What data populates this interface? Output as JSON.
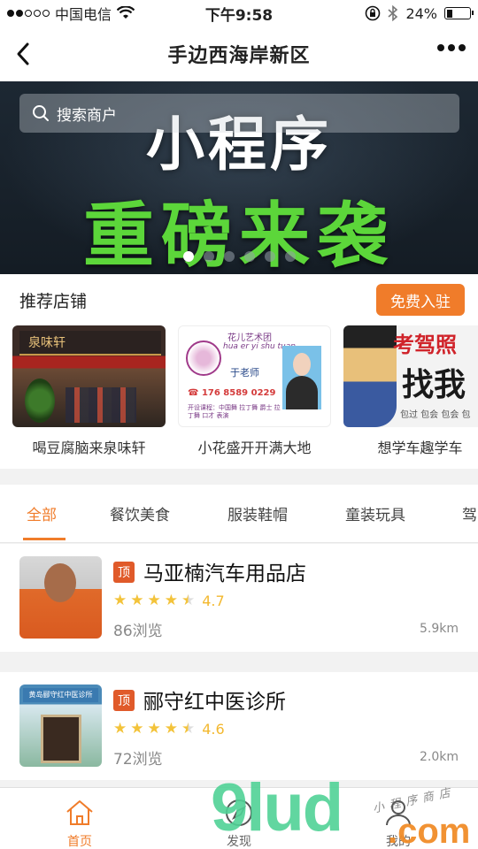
{
  "status_bar": {
    "carrier": "中国电信",
    "time": "下午9:58",
    "battery": "24%",
    "battery_level": 0.24,
    "signal_icon": "signal-dots-icon",
    "wifi_icon": "wifi-icon"
  },
  "nav": {
    "title": "手边西海岸新区",
    "back_icon": "back-chevron-icon",
    "more_icon": "more-dots-icon"
  },
  "banner": {
    "search_placeholder": "搜索商户",
    "line1": "小程序",
    "line2": "重磅来袭",
    "slide_count": 6,
    "active_slide": 1
  },
  "recommend": {
    "heading": "推荐店铺",
    "join_button": "免费入驻",
    "shops": [
      {
        "name": "喝豆腐脑来泉味轩",
        "sign_text": "泉味轩"
      },
      {
        "name": "小花盛开开满大地",
        "img_title": "花儿艺术团",
        "img_pinyin": "hua er yi shu tuan",
        "img_teacher": "于老师",
        "img_phone": "☎ 176 8589 0229",
        "img_courses": "开设课程：中国舞 拉丁舞 爵士 拉丁舞 口才 表演"
      },
      {
        "name": "想学车趣学车",
        "img_line1": "考驾照",
        "img_line2": "找我",
        "img_line3": "包过 包会 包会 包"
      }
    ]
  },
  "category_tabs": {
    "items": [
      "全部",
      "餐饮美食",
      "服装鞋帽",
      "童装玩具",
      "驾"
    ],
    "active_index": 0
  },
  "listings": [
    {
      "tag": "顶",
      "title": "马亚楠汽车用品店",
      "rating": "4.7",
      "views": "86浏览",
      "distance": "5.9km",
      "stars_full": 4,
      "stars_half": 1
    },
    {
      "tag": "顶",
      "title": "郦守红中医诊所",
      "rating": "4.6",
      "views": "72浏览",
      "distance": "2.0km",
      "stars_full": 4,
      "stars_half": 1,
      "img_sign": "黄岛郦守红中医诊所"
    }
  ],
  "tabbar": {
    "items": [
      {
        "label": "首页",
        "icon": "home-icon",
        "active": true
      },
      {
        "label": "发现",
        "icon": "compass-icon",
        "active": false
      },
      {
        "label": "我的",
        "icon": "user-icon",
        "active": false
      }
    ]
  },
  "watermark": {
    "logo": "9lud",
    "domain": ".com",
    "tagline": "小程序商店"
  },
  "colors": {
    "accent": "#f07c2a",
    "tag": "#e05a2a",
    "star": "#f3c33a",
    "banner_green": "#5cd63a"
  }
}
